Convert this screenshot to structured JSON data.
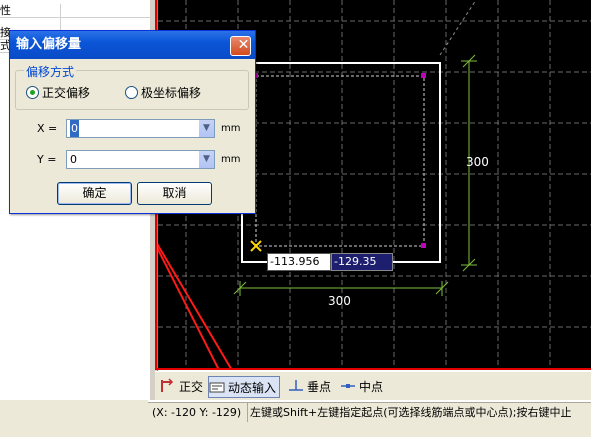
{
  "left_panel": {
    "rows": [
      "性",
      "",
      "接",
      "式"
    ]
  },
  "canvas": {
    "dim_vertical": "300",
    "dim_horizontal": "300",
    "input_x_value": "-113.956",
    "input_y_value": "-129.35",
    "colors": {
      "background": "#000000",
      "rect": "#ffffff",
      "grid": "#6a6a6a",
      "dim": "#7fbf3f",
      "snap": "#c000c0",
      "cursor": "#ffd800"
    }
  },
  "dialog": {
    "title": "输入偏移量",
    "close_symbol": "✕",
    "group_label": "偏移方式",
    "radio_ortho": "正交偏移",
    "radio_polar": "极坐标偏移",
    "x_label": "X =",
    "x_value": "0",
    "x_unit": "mm",
    "y_label": "Y =",
    "y_value": "0",
    "y_unit": "mm",
    "ok_label": "确定",
    "cancel_label": "取消"
  },
  "toolbar": {
    "ortho_label": "正交",
    "dynamic_input_label": "动态输入",
    "perpendicular_label": "垂点",
    "midpoint_label": "中点"
  },
  "status": {
    "coords": "(X: -120 Y: -129)",
    "message": "左键或Shift+左键指定起点(可选择线筋端点或中心点);按右键中止"
  }
}
